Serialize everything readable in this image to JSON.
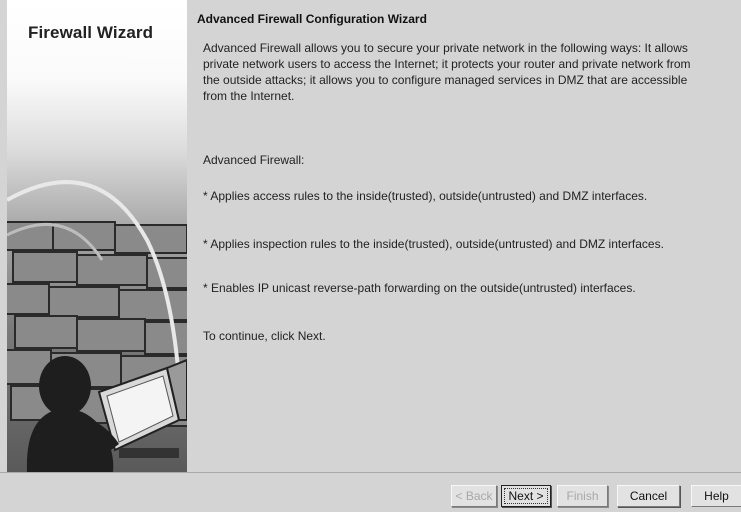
{
  "side_panel": {
    "title": "Firewall Wizard"
  },
  "main": {
    "heading": "Advanced Firewall Configuration Wizard",
    "intro": "Advanced Firewall allows you to secure your private network in the following ways: It allows private network users to access the Internet; it protects your router and private network from the outside attacks; it allows you to configure managed services in DMZ that are accessible from the Internet.",
    "section_label": "Advanced Firewall:",
    "bullets": [
      "* Applies access rules to the inside(trusted), outside(untrusted) and DMZ interfaces.",
      "* Applies inspection rules to the inside(trusted), outside(untrusted) and DMZ interfaces.",
      "* Enables IP unicast reverse-path forwarding on the outside(untrusted) interfaces."
    ],
    "continue_text": "To continue, click Next."
  },
  "footer": {
    "back_label": "< Back",
    "next_label": "Next >",
    "finish_label": "Finish",
    "cancel_label": "Cancel",
    "help_label": "Help"
  }
}
